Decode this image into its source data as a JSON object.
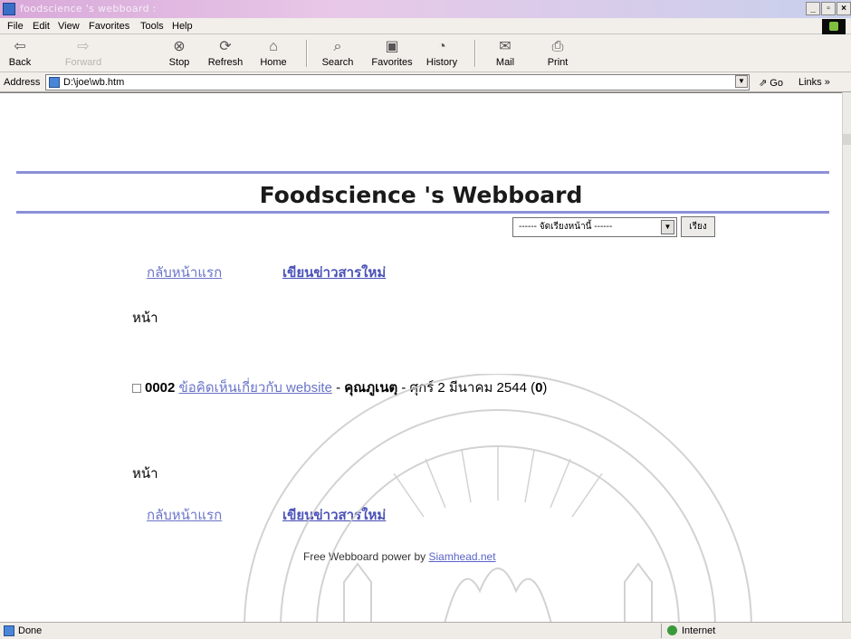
{
  "window": {
    "title": "foodscience 's webboard :",
    "controls": [
      "_",
      "▫",
      "×"
    ]
  },
  "menu": {
    "items": [
      "File",
      "Edit",
      "View",
      "Favorites",
      "Tools",
      "Help"
    ]
  },
  "toolbar": {
    "back": "Back",
    "forward": "Forward",
    "stop": "Stop",
    "refresh": "Refresh",
    "home": "Home",
    "search": "Search",
    "favorites": "Favorites",
    "history": "History",
    "mail": "Mail",
    "print": "Print"
  },
  "address": {
    "label": "Address",
    "value": "D:\\joe\\wb.htm",
    "go": "Go",
    "links": "Links »"
  },
  "page": {
    "title": "Foodscience 's Webboard",
    "nav_home": "กลับหน้าแรก",
    "nav_new_post": "เขียนข่าวสารใหม่",
    "page_label": "หน้า",
    "sort_placeholder": "------ จัดเรียงหน้านี้ ------",
    "sort_button": "เรียง",
    "post": {
      "number": "0002",
      "subject": "ข้อคิดเห็นเกี่ยวกับ website",
      "sep1": " - ",
      "author": "คุณภูเนตุ",
      "sep2": " - ศุกร์ 2 มีนาคม 2544 (",
      "replies": "0",
      "close": ")"
    },
    "footer_prefix": "Free Webboard power by ",
    "footer_link": "Siamhead.net"
  },
  "status": {
    "text": "Done",
    "zone": "Internet"
  }
}
